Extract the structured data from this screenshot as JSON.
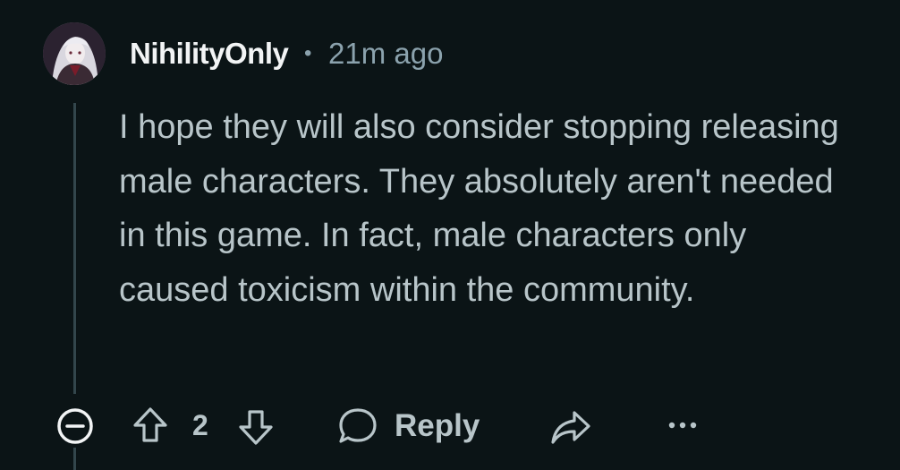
{
  "comment": {
    "username": "NihilityOnly",
    "separator": "•",
    "timestamp": "21m ago",
    "body": "I hope they will also consider stopping releasing male characters. They absolutely aren't needed in this game. In fact, male characters only caused toxicism within the community.",
    "score": "2",
    "reply_label": "Reply"
  },
  "icons": {
    "avatar": "user-avatar",
    "collapse": "collapse-thread-icon",
    "upvote": "upvote-arrow-icon",
    "downvote": "downvote-arrow-icon",
    "reply": "speech-bubble-icon",
    "share": "share-arrow-icon",
    "more": "ellipsis-icon"
  },
  "colors": {
    "background": "#0b1416",
    "username": "#f2f4f5",
    "meta": "#8ba2ad",
    "text": "#b8c5c9",
    "thread_line": "#33464c"
  }
}
